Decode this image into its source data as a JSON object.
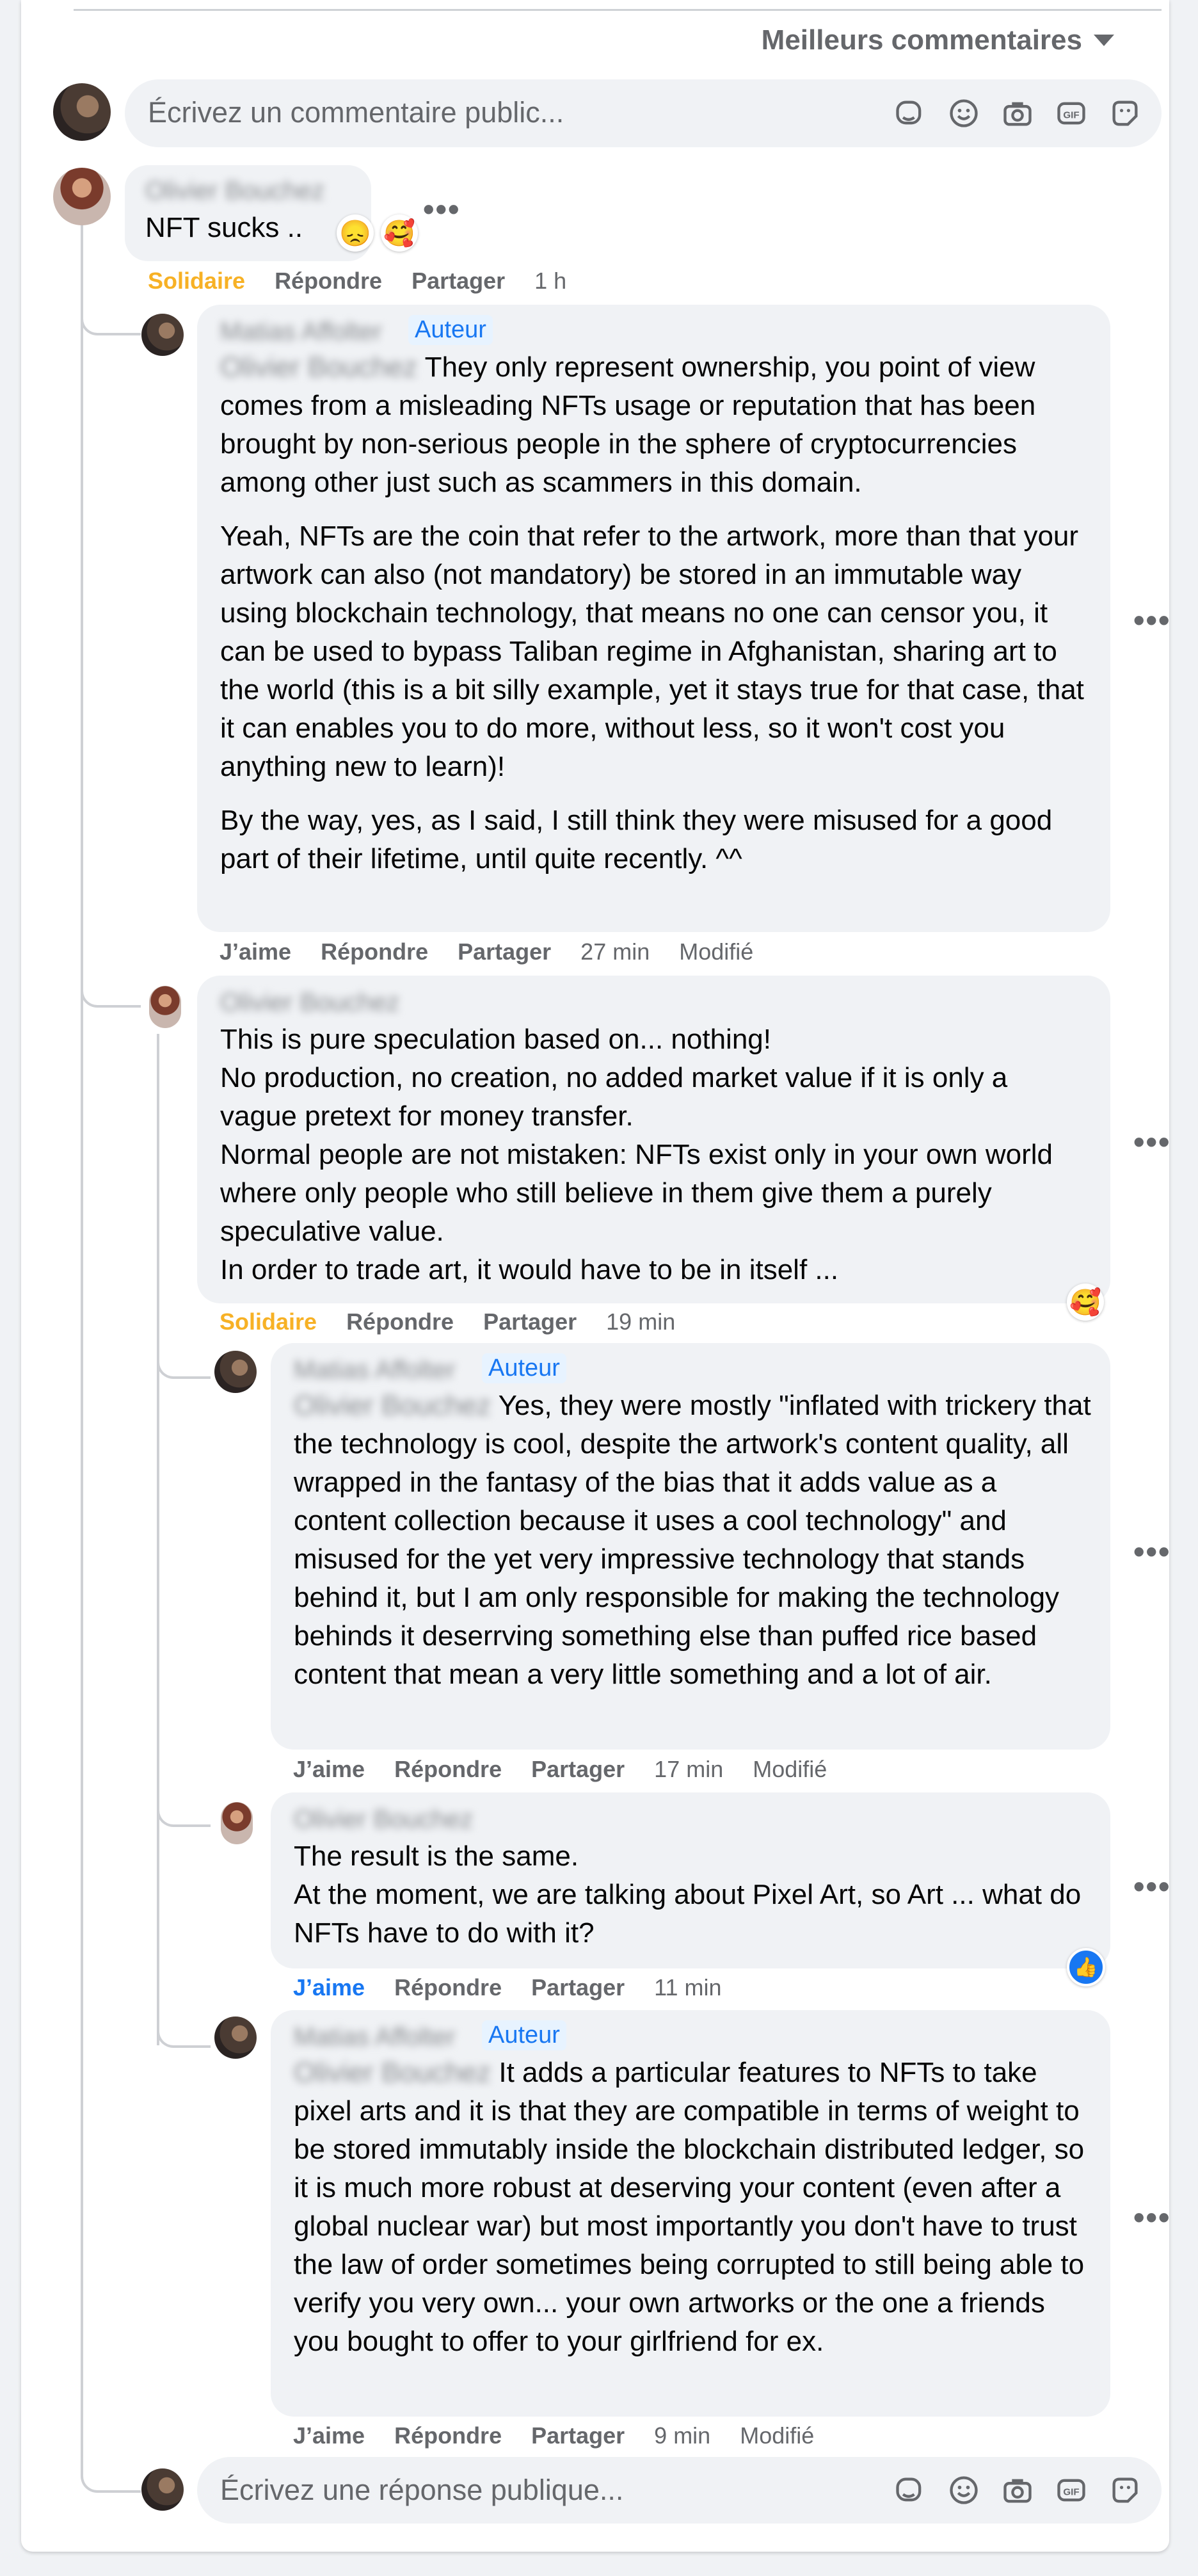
{
  "sort_label": "Meilleurs commentaires",
  "composer": {
    "placeholder": "Écrivez un commentaire public..."
  },
  "reply_composer": {
    "placeholder": "Écrivez une réponse publique..."
  },
  "author_badge": "Auteur",
  "more_label": "•••",
  "comments": [
    {
      "name": "Olivier Bouchez",
      "text": "NFT sucks ..",
      "reactions": [
        "😞",
        "🥰"
      ],
      "actions": {
        "react": "Solidaire",
        "reply": "Répondre",
        "share": "Partager",
        "time": "1 h"
      }
    },
    {
      "name": "Matias Affolter",
      "mention": "Olivier Bouchez",
      "text_p1": " They only represent ownership, you point of view comes from a misleading NFTs usage or reputation that has been brought by non-serious people in the sphere of cryptocurrencies among other just such as scammers in this domain.",
      "text_p2": "Yeah, NFTs are the coin that refer to the artwork, more than that your artwork can also (not mandatory) be stored in an immutable way using blockchain technology, that means no one can censor you, it can be used to bypass Taliban regime in Afghanistan, sharing art to the world (this is a bit silly example, yet it stays true for that case, that it can enables you to do more, without less, so it won't cost you anything new to learn)!",
      "text_p3": "By the way, yes, as I said, I still think they were misused for a good part of their lifetime, until quite recently. ^^",
      "actions": {
        "react": "J’aime",
        "reply": "Répondre",
        "share": "Partager",
        "time": "27 min",
        "edited": "Modifié"
      }
    },
    {
      "name": "Olivier Bouchez",
      "line1": "This is pure speculation based on... nothing!",
      "line2": "No production, no creation, no added market value if it is only a vague pretext for money transfer.",
      "line3": "Normal people are not mistaken: NFTs exist only in your own world where only people who still believe in them give them a purely speculative value.",
      "line4": "In order to trade art, it would have to be in itself ...",
      "reaction": "🥰",
      "actions": {
        "react": "Solidaire",
        "reply": "Répondre",
        "share": "Partager",
        "time": "19 min"
      }
    },
    {
      "name": "Matias Affolter",
      "mention": "Olivier Bouchez",
      "text": " Yes, they were mostly \"inflated with trickery that the technology is cool, despite the artwork's content quality, all wrapped in the fantasy of the bias that it adds value as a content collection because it uses a cool technology\" and misused for the yet very impressive technology that stands behind it, but I am only responsible for making the technology behinds it deserrving something else than puffed rice based content that mean a very little something and a lot of air.",
      "actions": {
        "react": "J’aime",
        "reply": "Répondre",
        "share": "Partager",
        "time": "17 min",
        "edited": "Modifié"
      }
    },
    {
      "name": "Olivier Bouchez",
      "line1": "The result is the same.",
      "line2": "At the moment, we are talking about Pixel Art, so Art ... what do NFTs have to do with it?",
      "actions": {
        "react": "J’aime",
        "reply": "Répondre",
        "share": "Partager",
        "time": "11 min"
      }
    },
    {
      "name": "Matias Affolter",
      "mention": "Olivier Bouchez",
      "text": " It adds a particular features to NFTs to take pixel arts and it is that they are compatible in terms of weight to be stored immutably inside the blockchain distributed ledger, so it is much more robust at deserving your content (even after a global nuclear war) but most importantly you don't have to trust the law of order sometimes being corrupted to still being able to verify you very own... your own artworks or the one a friends you bought to offer to your girlfriend for ex.",
      "actions": {
        "react": "J’aime",
        "reply": "Répondre",
        "share": "Partager",
        "time": "9 min",
        "edited": "Modifié"
      }
    }
  ]
}
